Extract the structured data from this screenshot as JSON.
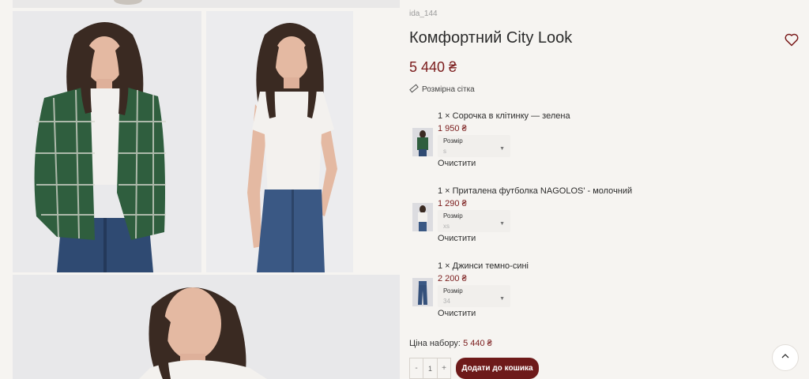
{
  "product": {
    "sku": "ida_144",
    "title": "Комфортний City Look",
    "price": "5 440 ₴",
    "size_chart_label": "Розмірна сітка",
    "favorite_icon": "heart-outline-icon"
  },
  "items": [
    {
      "title": "1 × Сорочка в клітинку — зелена",
      "price": "1 950 ₴",
      "size_label": "Розмір",
      "size_value": "s",
      "clear_label": "Очистити"
    },
    {
      "title": "1 × Приталена футболка NAGOLOS' - молочний",
      "price": "1 290 ₴",
      "size_label": "Розмір",
      "size_value": "xs",
      "clear_label": "Очистити"
    },
    {
      "title": "1 × Джинси темно-сині",
      "price": "2 200 ₴",
      "size_label": "Розмір",
      "size_value": "34",
      "clear_label": "Очистити"
    }
  ],
  "set_price": {
    "label": "Ціна набору:",
    "value": "5 440 ₴"
  },
  "cart": {
    "qty_minus": "-",
    "qty_value": "1",
    "qty_plus": "+",
    "add_label": "Додати до кошика"
  },
  "colors": {
    "accent": "#7a1b1b",
    "button": "#6e1a1a",
    "background": "#f6f4f1"
  }
}
